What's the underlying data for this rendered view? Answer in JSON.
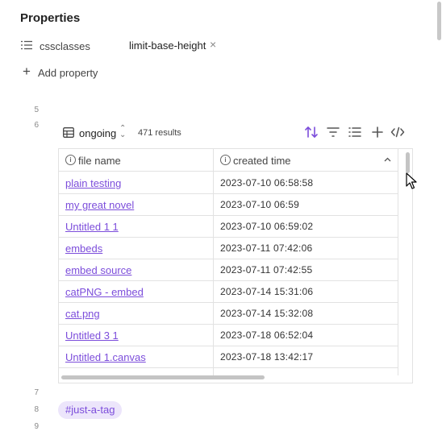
{
  "properties": {
    "title": "Properties",
    "rows": [
      {
        "key": "cssclasses",
        "value": "limit-base-height",
        "remove": "×"
      }
    ],
    "add_label": "Add property"
  },
  "line_numbers": [
    "5",
    "6",
    "7",
    "8",
    "9"
  ],
  "base": {
    "view_name": "ongoing",
    "results": "471 results",
    "toolbar_icons": [
      "sort-icon",
      "filter-icon",
      "properties-icon",
      "add-icon",
      "code-icon"
    ],
    "columns": [
      "file name",
      "created time"
    ],
    "rows": [
      {
        "name": "plain testing",
        "time": "2023-07-10 06:58:58"
      },
      {
        "name": "my great novel",
        "time": "2023-07-10 06:59"
      },
      {
        "name": "Untitled 1 1",
        "time": "2023-07-10 06:59:02"
      },
      {
        "name": "embeds",
        "time": "2023-07-11 07:42:06"
      },
      {
        "name": "embed source",
        "time": "2023-07-11 07:42:55"
      },
      {
        "name": "catPNG - embed",
        "time": "2023-07-14 15:31:06"
      },
      {
        "name": "cat.png",
        "time": "2023-07-14 15:32:08"
      },
      {
        "name": "Untitled 3 1",
        "time": "2023-07-18 06:52:04"
      },
      {
        "name": "Untitled 1.canvas",
        "time": "2023-07-18 13:42:17"
      }
    ]
  },
  "tag": "#just-a-tag",
  "colors": {
    "accent": "#7c4ddb",
    "tag_bg": "#ece5fb",
    "border": "#e2e2e2"
  }
}
